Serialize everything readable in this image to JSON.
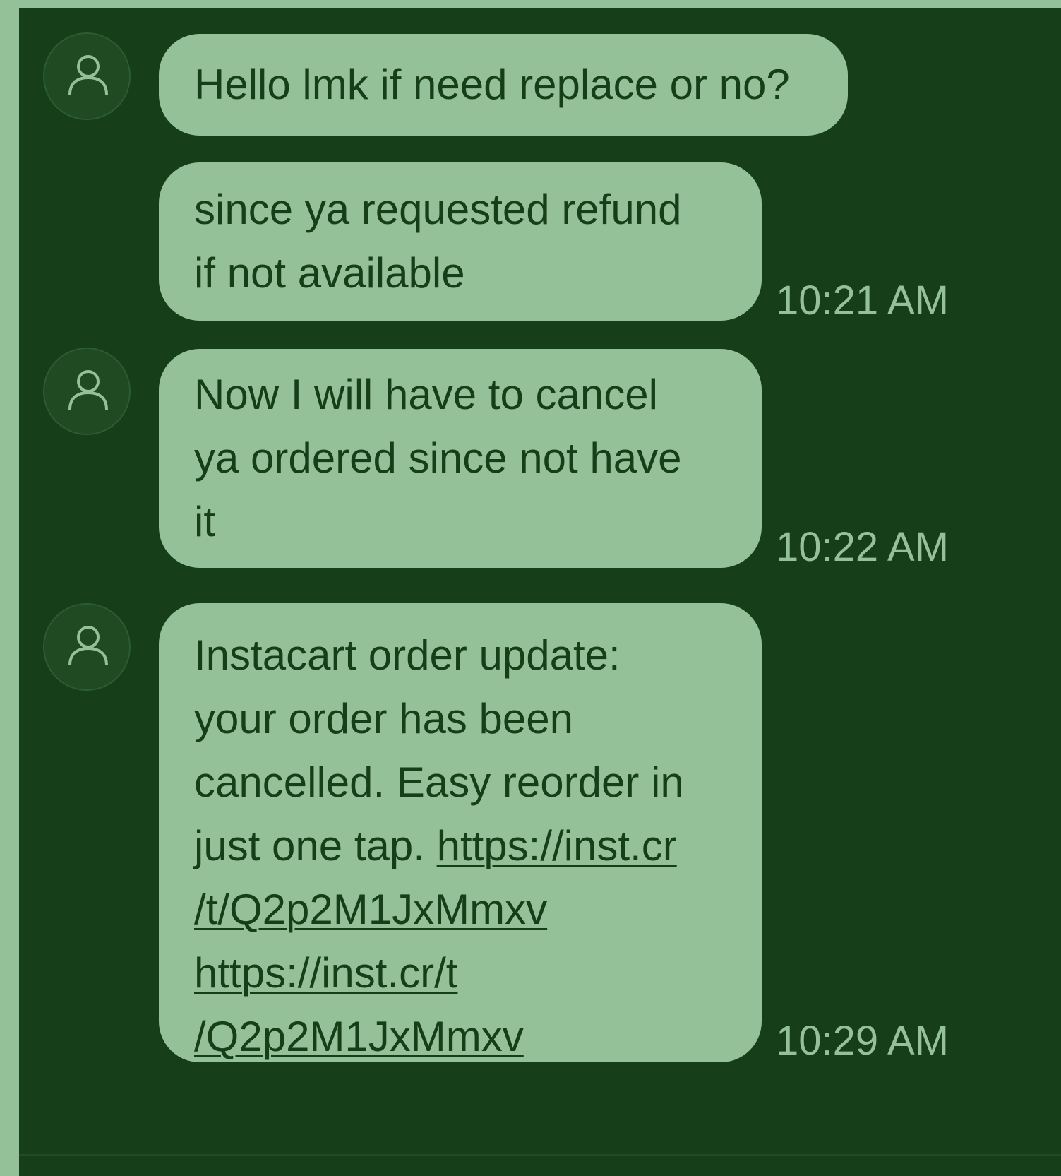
{
  "messages": [
    {
      "lines": [
        "Hello lmk if need replace or no?"
      ]
    },
    {
      "lines": [
        "since ya requested refund",
        "if not available"
      ],
      "time": "10:21 AM"
    },
    {
      "lines": [
        "Now I will have to cancel",
        "ya ordered since not have",
        "it"
      ],
      "time": "10:22 AM"
    },
    {
      "lines": [
        "Instacart order update:",
        "your order has been",
        "cancelled. Easy reorder in",
        "just one tap. "
      ],
      "link1_part1": "https://inst.cr",
      "link1_part2": "/t/Q2p2M1JxMmxv",
      "link2_part1": "https://inst.cr/t",
      "link2_part2": "/Q2p2M1JxMmxv",
      "time": "10:29 AM"
    }
  ],
  "icons": {
    "avatar": "person-icon"
  },
  "colors": {
    "outer_background": "#95c198",
    "thread_background": "#163e19",
    "bubble": "#95c198",
    "bubble_text": "#163e19",
    "timestamp": "#95c198"
  }
}
